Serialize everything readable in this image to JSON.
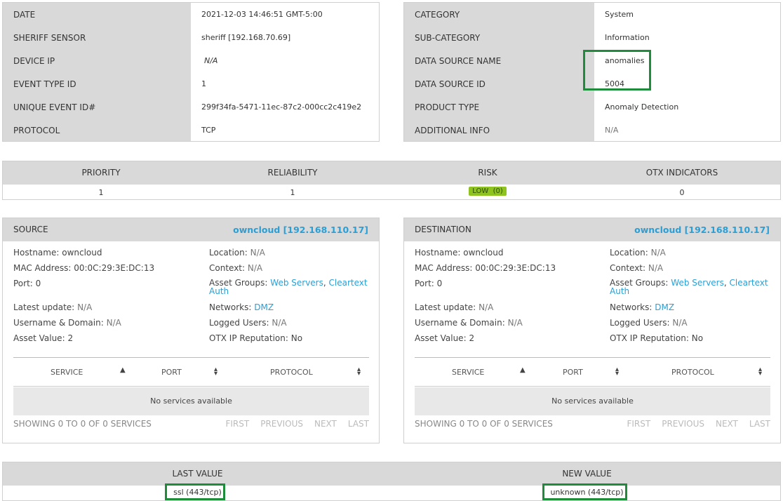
{
  "event_details": {
    "left": [
      {
        "label": "DATE",
        "value": "2021-12-03 14:46:51 GMT-5:00"
      },
      {
        "label": "SHERIFF SENSOR",
        "value": "sheriff [192.168.70.69]"
      },
      {
        "label": "DEVICE IP",
        "value": "N/A"
      },
      {
        "label": "EVENT TYPE ID",
        "value": "1"
      },
      {
        "label": "UNIQUE EVENT ID#",
        "value": "299f34fa-5471-11ec-87c2-000cc2c419e2"
      },
      {
        "label": "PROTOCOL",
        "value": "TCP"
      }
    ],
    "right": [
      {
        "label": "CATEGORY",
        "value": "System"
      },
      {
        "label": "SUB-CATEGORY",
        "value": "Information"
      },
      {
        "label": "DATA SOURCE NAME",
        "value": "anomalies"
      },
      {
        "label": "DATA SOURCE ID",
        "value": "5004"
      },
      {
        "label": "PRODUCT TYPE",
        "value": "Anomaly Detection"
      },
      {
        "label": "ADDITIONAL INFO",
        "value": "N/A"
      }
    ]
  },
  "metrics": {
    "headers": [
      "PRIORITY",
      "RELIABILITY",
      "RISK",
      "OTX INDICATORS"
    ],
    "priority": "1",
    "reliability": "1",
    "risk": "LOW  (0)",
    "otx_indicators": "0",
    "risk_color": "#8fc31f"
  },
  "source": {
    "title": "SOURCE",
    "link": "owncloud [192.168.110.17]",
    "hostname_label": "Hostname:",
    "hostname": "owncloud",
    "mac_label": "MAC Address:",
    "mac": "00:0C:29:3E:DC:13",
    "port_label": "Port:",
    "port": "0",
    "latest_label": "Latest update:",
    "latest": "N/A",
    "user_label": "Username & Domain:",
    "user": "N/A",
    "asset_value_label": "Asset Value:",
    "asset_value": "2",
    "location_label": "Location:",
    "location": "N/A",
    "context_label": "Context:",
    "context": "N/A",
    "asset_groups_label": "Asset Groups:",
    "asset_group_1": "Web Servers",
    "asset_group_2": "Cleartext Auth",
    "networks_label": "Networks:",
    "network": "DMZ",
    "logged_label": "Logged Users:",
    "logged": "N/A",
    "otx_rep_label": "OTX IP Reputation:",
    "otx_rep": "No",
    "services": {
      "col_service": "SERVICE",
      "col_port": "PORT",
      "col_protocol": "PROTOCOL",
      "empty": "No services available",
      "showing": "SHOWING 0 TO 0 OF 0 SERVICES",
      "first": "FIRST",
      "previous": "PREVIOUS",
      "next": "NEXT",
      "last": "LAST"
    }
  },
  "destination": {
    "title": "DESTINATION",
    "link": "owncloud [192.168.110.17]",
    "hostname_label": "Hostname:",
    "hostname": "owncloud",
    "mac_label": "MAC Address:",
    "mac": "00:0C:29:3E:DC:13",
    "port_label": "Port:",
    "port": "0",
    "latest_label": "Latest update:",
    "latest": "N/A",
    "user_label": "Username & Domain:",
    "user": "N/A",
    "asset_value_label": "Asset Value:",
    "asset_value": "2",
    "location_label": "Location:",
    "location": "N/A",
    "context_label": "Context:",
    "context": "N/A",
    "asset_groups_label": "Asset Groups:",
    "asset_group_1": "Web Servers",
    "asset_group_2": "Cleartext Auth",
    "networks_label": "Networks:",
    "network": "DMZ",
    "logged_label": "Logged Users:",
    "logged": "N/A",
    "otx_rep_label": "OTX IP Reputation:",
    "otx_rep": "No",
    "services": {
      "col_service": "SERVICE",
      "col_port": "PORT",
      "col_protocol": "PROTOCOL",
      "empty": "No services available",
      "showing": "SHOWING 0 TO 0 OF 0 SERVICES",
      "first": "FIRST",
      "previous": "PREVIOUS",
      "next": "NEXT",
      "last": "LAST"
    }
  },
  "values": {
    "last_header": "LAST VALUE",
    "new_header": "NEW VALUE",
    "last_value": "ssl (443/tcp)",
    "new_value": "unknown (443/tcp)"
  },
  "highlight_color": "#1e8c3a"
}
